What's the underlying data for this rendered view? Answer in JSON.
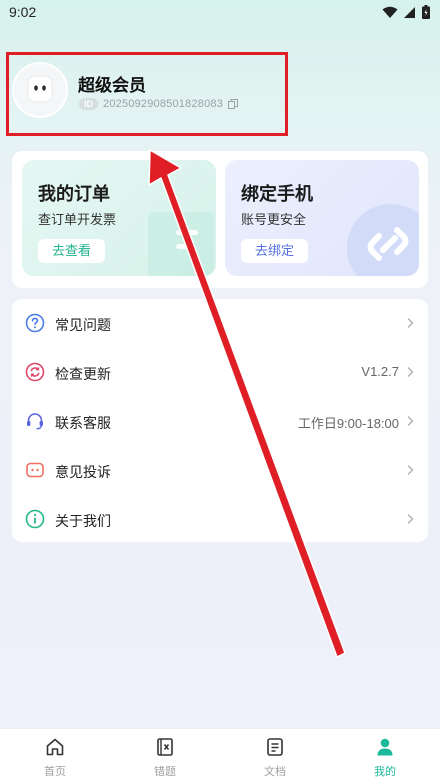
{
  "status_bar": {
    "time": "9:02"
  },
  "profile": {
    "username": "超级会员",
    "id_badge": "ID",
    "user_id": "2025092908501828083"
  },
  "cards": [
    {
      "title": "我的订单",
      "subtitle": "查订单开发票",
      "button": "去查看"
    },
    {
      "title": "绑定手机",
      "subtitle": "账号更安全",
      "button": "去绑定"
    }
  ],
  "menu": [
    {
      "label": "常见问题",
      "value": "",
      "icon": "question-icon"
    },
    {
      "label": "检查更新",
      "value": "V1.2.7",
      "icon": "refresh-icon"
    },
    {
      "label": "联系客服",
      "value": "工作日9:00-18:00",
      "icon": "headset-icon"
    },
    {
      "label": "意见投诉",
      "value": "",
      "icon": "feedback-icon"
    },
    {
      "label": "关于我们",
      "value": "",
      "icon": "info-icon"
    }
  ],
  "tabbar": [
    {
      "label": "首页",
      "icon": "home-icon"
    },
    {
      "label": "错题",
      "icon": "mistakes-book-icon"
    },
    {
      "label": "文档",
      "icon": "document-icon"
    },
    {
      "label": "我的",
      "icon": "user-icon"
    }
  ],
  "colors": {
    "accent": "#1cb89a",
    "annotation_red": "#e01e26",
    "question": "#4a7ee6",
    "refresh": "#e0486a",
    "headset": "#5a64e0",
    "feedback": "#f07060",
    "info": "#25b88a"
  }
}
